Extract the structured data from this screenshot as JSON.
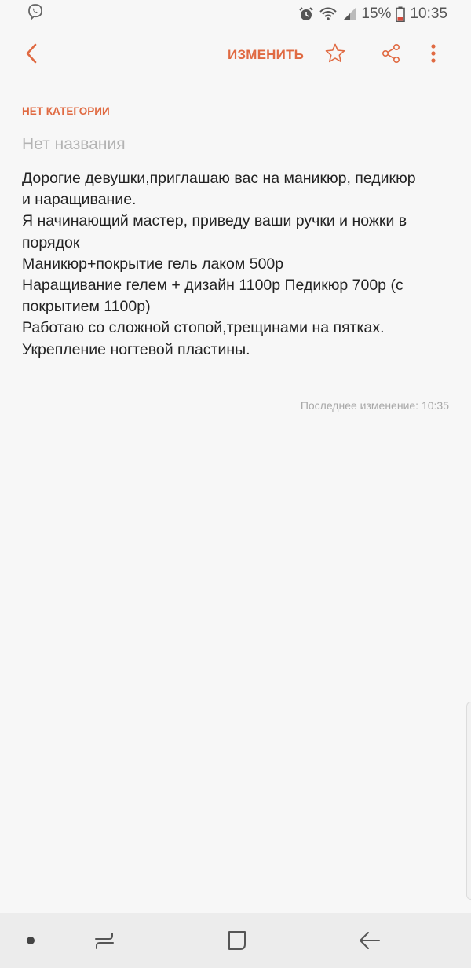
{
  "status_bar": {
    "battery_percent": "15%",
    "time": "10:35",
    "icons": [
      "viber-icon",
      "alarm-icon",
      "wifi-icon",
      "signal-icon",
      "battery-icon"
    ]
  },
  "toolbar": {
    "edit_label": "ИЗМЕНИТЬ",
    "icons": [
      "back-arrow-icon",
      "star-icon",
      "share-icon",
      "more-vert-icon"
    ]
  },
  "note": {
    "category": "НЕТ КАТЕГОРИИ",
    "title_placeholder": "Нет названия",
    "body_lines": [
      "Дорогие девушки,приглашаю вас на маникюр, педикюр",
      "и наращивание.",
      "Я начинающий мастер, приведу ваши ручки и ножки в",
      "порядок",
      "Маникюр+покрытие гель лаком 500р",
      "Наращивание гелем + дизайн 1100р Педикюр 700р (с",
      "покрытием 1100р)",
      "Работаю со сложной стопой,трещинами на пятках.",
      "Укрепление ногтевой пластины."
    ],
    "last_modified": "Последнее изменение: 10:35"
  },
  "nav_bar": {
    "icons": [
      "nav-dot-icon",
      "recents-icon",
      "home-icon",
      "back-icon"
    ]
  },
  "colors": {
    "accent": "#e06a42",
    "background": "#f7f7f7",
    "nav_background": "#ececec"
  }
}
